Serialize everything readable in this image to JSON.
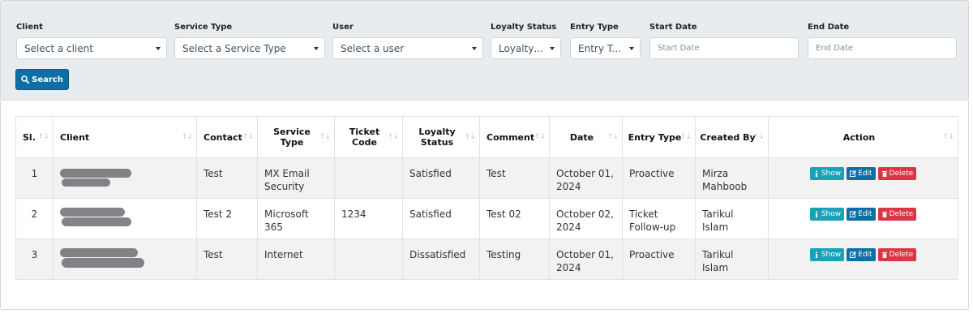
{
  "filters": {
    "client": {
      "label": "Client",
      "value": "Select a client"
    },
    "service_type": {
      "label": "Service Type",
      "value": "Select a Service Type"
    },
    "user": {
      "label": "User",
      "value": "Select a user"
    },
    "loyalty_status": {
      "label": "Loyalty Status",
      "value": "Loyalty Status"
    },
    "entry_type": {
      "label": "Entry Type",
      "value": "Entry Type"
    },
    "start_date": {
      "label": "Start Date",
      "placeholder": "Start Date"
    },
    "end_date": {
      "label": "End Date",
      "placeholder": "End Date"
    },
    "search_label": "Search"
  },
  "table": {
    "headers": {
      "sl": "Sl.",
      "client": "Client",
      "contact": "Contact",
      "service_type": "Service Type",
      "ticket_code": "Ticket Code",
      "loyalty_status": "Loyalty Status",
      "comment": "Comment",
      "date": "Date",
      "entry_type": "Entry Type",
      "created_by": "Created By",
      "action": "Action"
    },
    "rows": [
      {
        "sl": "1",
        "contact": "Test",
        "service_type": "MX Email Security",
        "ticket_code": "",
        "loyalty_status": "Satisfied",
        "comment": "Test",
        "date": "October 01, 2024",
        "entry_type": "Proactive",
        "created_by": "Mirza Mahboob"
      },
      {
        "sl": "2",
        "contact": "Test 2",
        "service_type": "Microsoft 365",
        "ticket_code": "1234",
        "loyalty_status": "Satisfied",
        "comment": "Test 02",
        "date": "October 02, 2024",
        "entry_type": "Ticket Follow-up",
        "created_by": "Tarikul Islam"
      },
      {
        "sl": "3",
        "contact": "Test",
        "service_type": "Internet",
        "ticket_code": "",
        "loyalty_status": "Dissatisfied",
        "comment": "Testing",
        "date": "October 01, 2024",
        "entry_type": "Proactive",
        "created_by": "Tarikul Islam"
      }
    ],
    "actions": {
      "show": "Show",
      "edit": "Edit",
      "delete": "Delete"
    },
    "sort_icon": "↑↓"
  },
  "colors": {
    "primary": "#0d6fa6",
    "info": "#17a2b8",
    "danger": "#dc3545"
  }
}
